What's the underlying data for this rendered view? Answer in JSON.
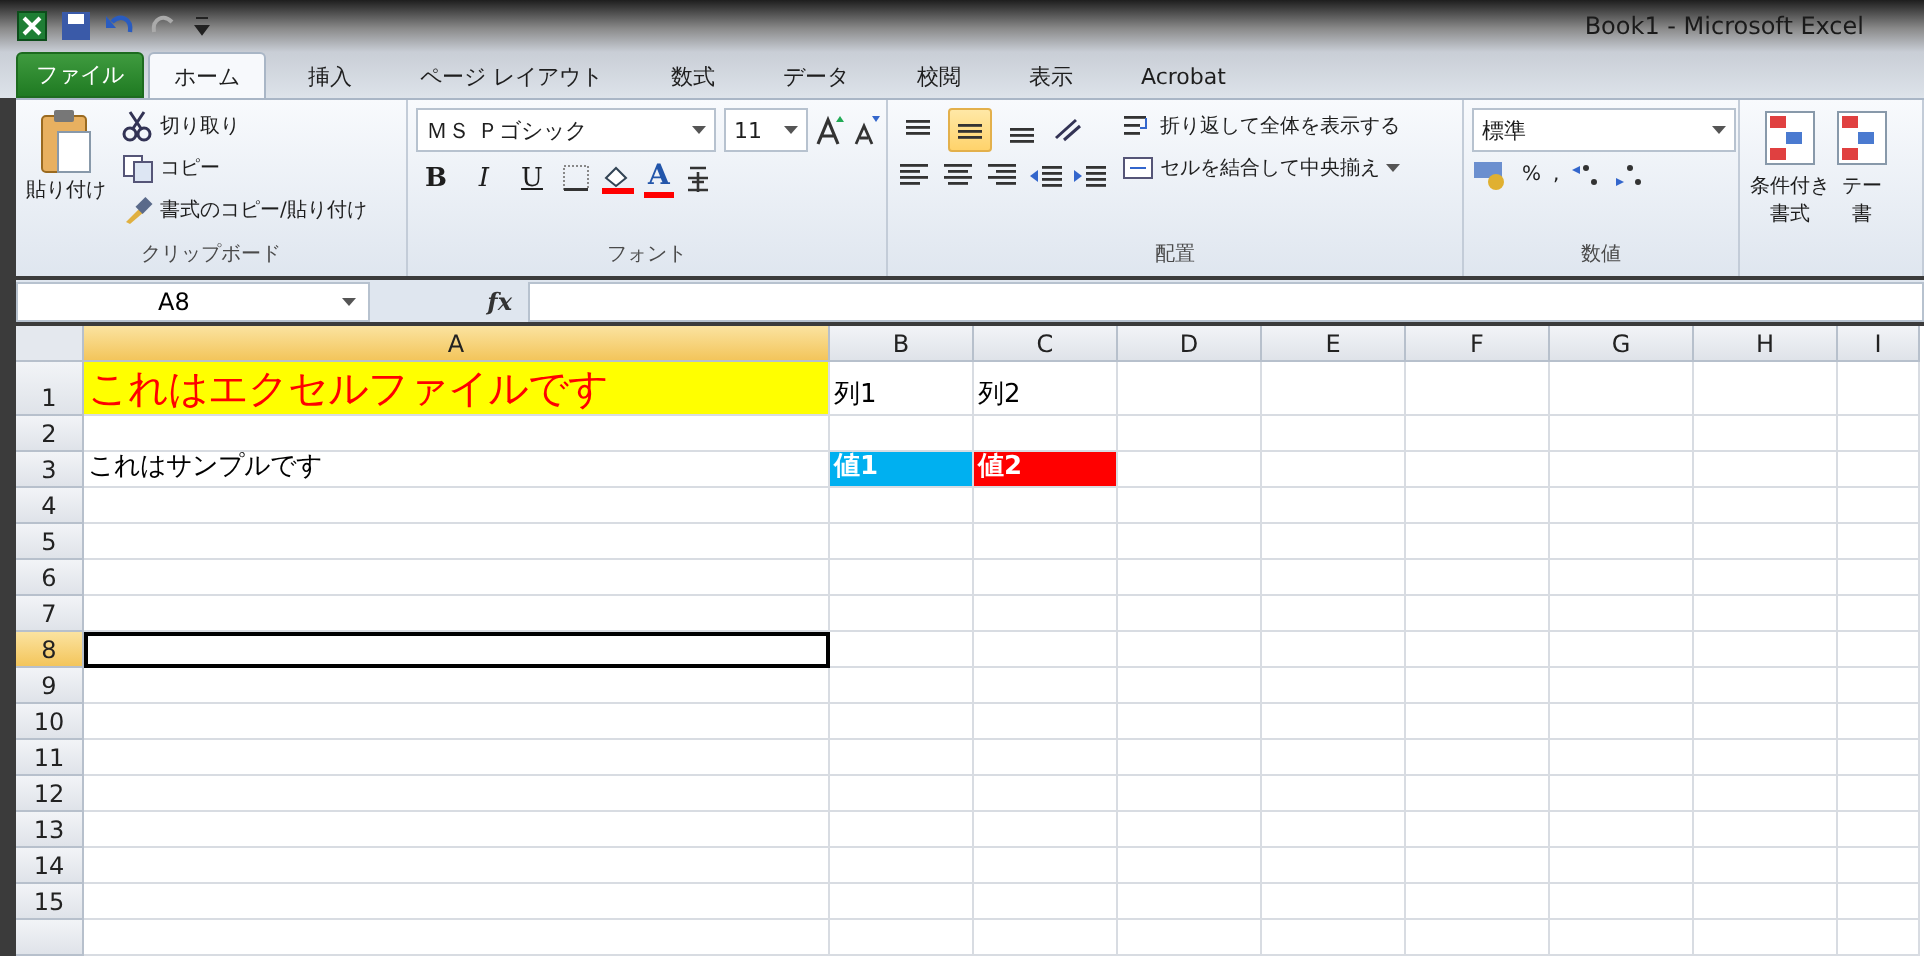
{
  "window": {
    "title": "Book1 - Microsoft Excel"
  },
  "tabs": [
    {
      "label": "ファイル",
      "kind": "file",
      "selected": false
    },
    {
      "label": "ホーム",
      "kind": "tab",
      "selected": true
    },
    {
      "label": "挿入",
      "kind": "tab",
      "selected": false
    },
    {
      "label": "ページ レイアウト",
      "kind": "tab",
      "selected": false
    },
    {
      "label": "数式",
      "kind": "tab",
      "selected": false
    },
    {
      "label": "データ",
      "kind": "tab",
      "selected": false
    },
    {
      "label": "校閲",
      "kind": "tab",
      "selected": false
    },
    {
      "label": "表示",
      "kind": "tab",
      "selected": false
    },
    {
      "label": "Acrobat",
      "kind": "tab",
      "selected": false
    }
  ],
  "ribbon": {
    "groups": [
      {
        "kind": "clipboard",
        "label": "クリップボード",
        "paste": "貼り付け",
        "cut": "切り取り",
        "copy": "コピー",
        "format_painter": "書式のコピー/貼り付け"
      },
      {
        "kind": "font",
        "label": "フォント",
        "font_name": "ＭＳ Ｐゴシック",
        "font_size": "11",
        "bold": "B",
        "italic": "I",
        "underline": "U",
        "font_color": "A"
      },
      {
        "kind": "alignment",
        "label": "配置",
        "vertical": [
          {
            "selected": false
          },
          {
            "selected": true
          },
          {
            "selected": false
          }
        ],
        "wrap": "折り返して全体を表示する",
        "merge": "セルを結合して中央揃え"
      },
      {
        "kind": "number",
        "label": "数値",
        "format": "標準",
        "percent": "%",
        "comma": ","
      },
      {
        "kind": "styles",
        "items": [
          {
            "top": "条件付き",
            "bottom": "書式"
          },
          {
            "top": "テー",
            "bottom": "書"
          }
        ]
      }
    ]
  },
  "formula_bar": {
    "name_box": "A8",
    "function_label": "fx"
  },
  "grid": {
    "columns": [
      {
        "label": "A",
        "selected": true
      },
      {
        "label": "B",
        "selected": false
      },
      {
        "label": "C",
        "selected": false
      },
      {
        "label": "D",
        "selected": false
      },
      {
        "label": "E",
        "selected": false
      },
      {
        "label": "F",
        "selected": false
      },
      {
        "label": "G",
        "selected": false
      },
      {
        "label": "H",
        "selected": false
      },
      {
        "label": "I",
        "selected": false
      }
    ],
    "rows": [
      {
        "label": "1",
        "selected": false,
        "cells": [
          {
            "text": "これはエクセルファイルです",
            "kind": "heading",
            "color": "#ffff00"
          },
          {
            "text": "列1",
            "kind": "plain"
          },
          {
            "text": "列2",
            "kind": "plain"
          }
        ]
      },
      {
        "label": "2",
        "selected": false
      },
      {
        "label": "3",
        "selected": false,
        "cells": [
          {
            "text": "これはサンプルです",
            "kind": "plain"
          },
          {
            "text": "値1",
            "kind": "highlight",
            "color": "#00b0f0"
          },
          {
            "text": "値2",
            "kind": "highlight",
            "color": "#ff0000"
          }
        ]
      },
      {
        "label": "4",
        "selected": false
      },
      {
        "label": "5",
        "selected": false
      },
      {
        "label": "6",
        "selected": false
      },
      {
        "label": "7",
        "selected": false
      },
      {
        "label": "8",
        "selected": true
      },
      {
        "label": "9",
        "selected": false
      },
      {
        "label": "10",
        "selected": false
      },
      {
        "label": "11",
        "selected": false
      },
      {
        "label": "12",
        "selected": false
      },
      {
        "label": "13",
        "selected": false
      },
      {
        "label": "14",
        "selected": false
      },
      {
        "label": "15",
        "selected": false
      }
    ]
  }
}
